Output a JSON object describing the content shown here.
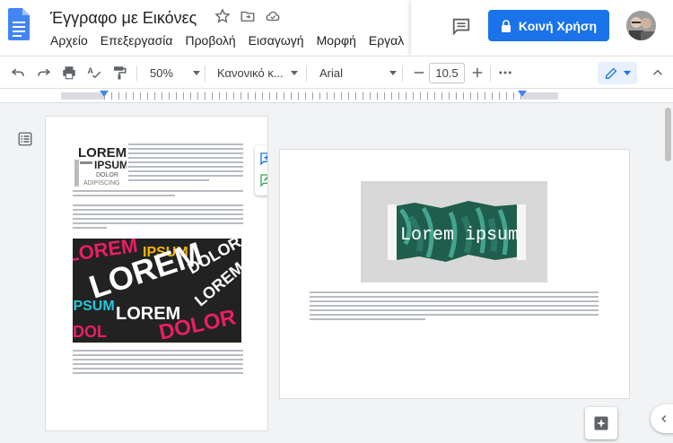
{
  "doc": {
    "title": "Έγγραφο με Εικόνες"
  },
  "menu": [
    "Αρχείο",
    "Επεξεργασία",
    "Προβολή",
    "Εισαγωγή",
    "Μορφή",
    "Εργαλ"
  ],
  "share": {
    "label": "Κοινή Χρήση"
  },
  "toolbar": {
    "zoom": "50%",
    "style": "Κανονικό κ...",
    "font": "Arial",
    "font_size": "10.5"
  },
  "page_left": {
    "heading_words": [
      "LOREM",
      "IPSUM",
      "DOLOR",
      "ADIPISCING"
    ],
    "collage_words": [
      "LOREM",
      "IPSUM",
      "DOLOR",
      "LOREM",
      "IPSUM",
      "LOREM",
      "DOLOR"
    ]
  },
  "page_right": {
    "image_text": "Lorem ipsum"
  },
  "colors": {
    "accent": "#1a73e8",
    "docs_blue": "#4285f4",
    "collage_pink": "#e91e63",
    "collage_yellow": "#f4b400",
    "collage_cyan": "#26c6da"
  }
}
